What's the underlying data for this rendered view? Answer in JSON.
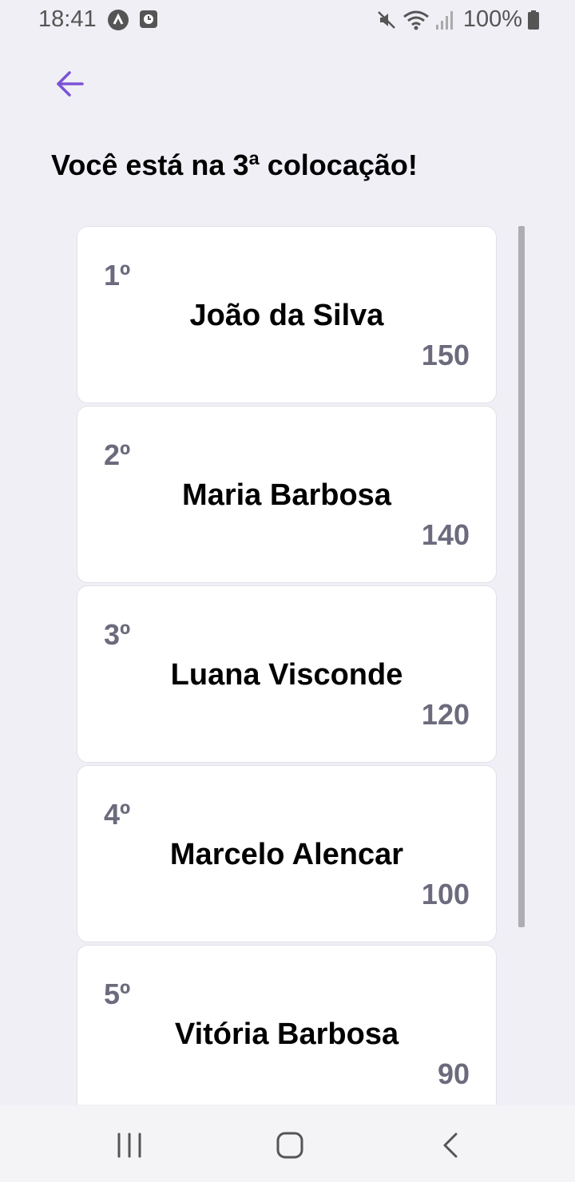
{
  "status_bar": {
    "time": "18:41",
    "battery": "100%",
    "icons": [
      "a-icon",
      "screen-record-icon",
      "mute-icon",
      "wifi-icon",
      "signal-icon",
      "battery-icon"
    ]
  },
  "header": {
    "back_icon": "arrow-left-icon",
    "title": "Você está na 3ª colocação!"
  },
  "ranking": [
    {
      "position": "1º",
      "name": "João da Silva",
      "score": "150"
    },
    {
      "position": "2º",
      "name": "Maria Barbosa",
      "score": "140"
    },
    {
      "position": "3º",
      "name": "Luana Visconde",
      "score": "120"
    },
    {
      "position": "4º",
      "name": "Marcelo Alencar",
      "score": "100"
    },
    {
      "position": "5º",
      "name": "Vitória Barbosa",
      "score": "90"
    }
  ],
  "nav_bar": {
    "icons": [
      "recent-apps-icon",
      "home-icon",
      "back-icon"
    ]
  },
  "colors": {
    "accent": "#7b52d6",
    "background": "#f0eff5",
    "card": "#ffffff",
    "muted_text": "#6b6b7d"
  }
}
